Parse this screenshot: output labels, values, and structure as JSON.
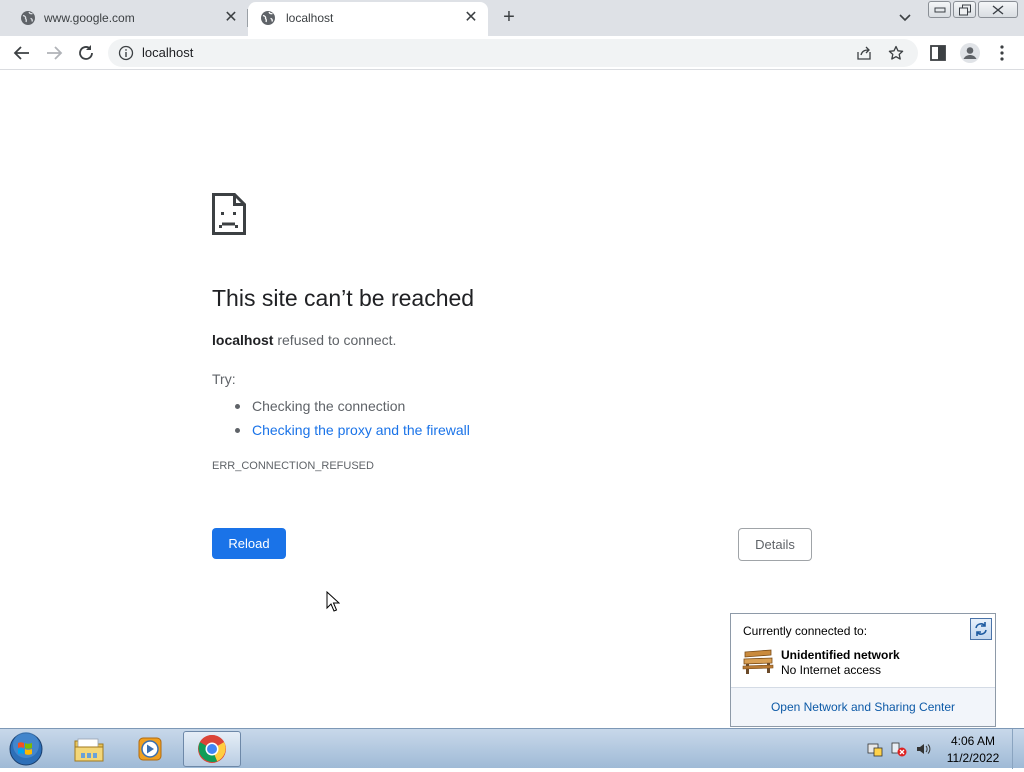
{
  "browser": {
    "tabs": [
      {
        "title": "www.google.com",
        "icon": "globe-icon",
        "active": false
      },
      {
        "title": "localhost",
        "icon": "globe-icon",
        "active": true
      }
    ],
    "new_tab_symbol": "+",
    "close_symbol": "✕",
    "address": "localhost"
  },
  "error_page": {
    "title": "This site can’t be reached",
    "host": "localhost",
    "message": " refused to connect.",
    "try_label": "Try:",
    "suggestions": [
      {
        "text": "Checking the connection",
        "link": false
      },
      {
        "text": "Checking the proxy and the firewall",
        "link": true
      }
    ],
    "error_code": "ERR_CONNECTION_REFUSED",
    "reload_label": "Reload",
    "details_label": "Details"
  },
  "network_flyout": {
    "heading": "Currently connected to:",
    "network_name": "Unidentified network",
    "network_status": "No Internet access",
    "link": "Open Network and Sharing Center"
  },
  "taskbar": {
    "apps": [
      "windows-explorer",
      "windows-media-player",
      "google-chrome"
    ],
    "active_app": "google-chrome",
    "time": "4:06 AM",
    "date": "11/2/2022"
  },
  "colors": {
    "accent": "#1a73e8",
    "tab_strip": "#dee1e6",
    "text_primary": "#202124",
    "text_secondary": "#5f6368"
  }
}
